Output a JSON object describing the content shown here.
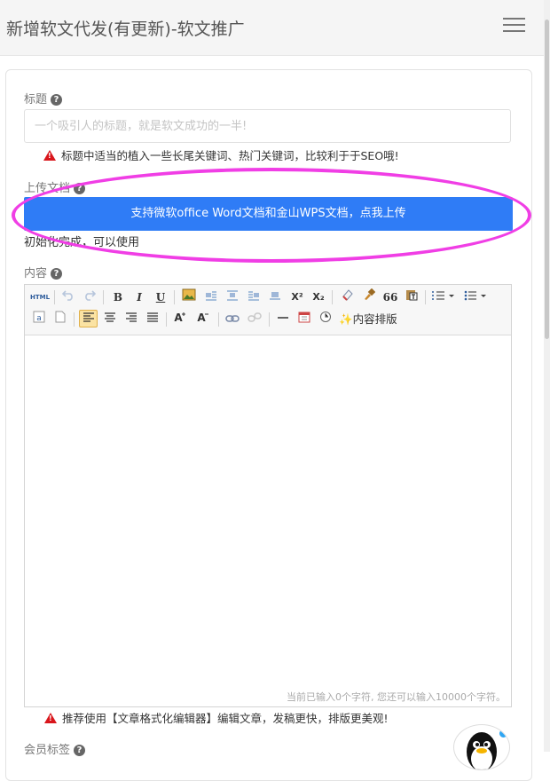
{
  "header": {
    "title": "新增软文代发(有更新)-软文推广"
  },
  "form": {
    "title_label": "标题",
    "title_placeholder": "一个吸引人的标题，就是软文成功的一半!",
    "title_tip": "标题中适当的植入一些长尾关键词、热门关键词，比较利于于SEO哦!",
    "upload_label": "上传文档",
    "upload_button": "支持微软office Word文档和金山WPS文档，点我上传",
    "upload_status": "初始化完成，可以使用",
    "content_label": "内容",
    "member_tag_label": "会员标签"
  },
  "toolbar": {
    "html": "HTML",
    "bold": "B",
    "italic": "I",
    "underline": "U",
    "superscript": "X²",
    "subscript": "X₂",
    "quote": "66",
    "layout_button": "内容排版"
  },
  "editor": {
    "counter": "当前已输入0个字符, 您还可以输入10000个字符。",
    "tip": "推荐使用【文章格式化编辑器】编辑文章，发稿更快，排版更美观!"
  },
  "help_glyph": "?",
  "colors": {
    "accent": "#2f7cf6",
    "warning": "#d9161c",
    "highlight": "#f03ee5"
  }
}
